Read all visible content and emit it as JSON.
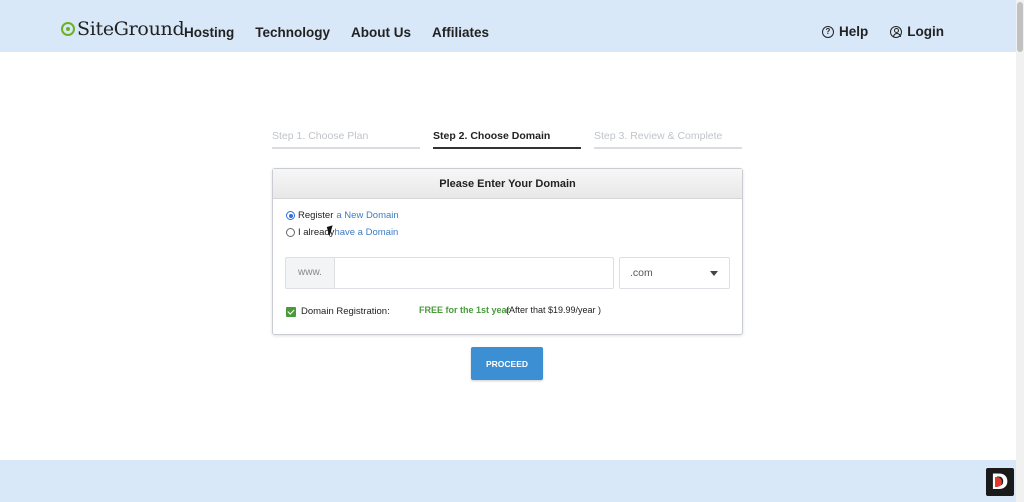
{
  "header": {
    "brand": "SiteGround",
    "nav": [
      "Hosting",
      "Technology",
      "About Us",
      "Affiliates"
    ],
    "help_label": "Help",
    "login_label": "Login",
    "help_icon": "?"
  },
  "steps": [
    {
      "label": "Step 1. Choose Plan",
      "active": false
    },
    {
      "label": "Step 2. Choose Domain",
      "active": true
    },
    {
      "label": "Step 3. Review & Complete",
      "active": false
    }
  ],
  "panel": {
    "title": "Please Enter Your Domain",
    "options": [
      {
        "prefix": "Register",
        "link": "a New Domain",
        "checked": true
      },
      {
        "prefix": "I already",
        "link": "have a Domain",
        "checked": false
      }
    ],
    "www_label": "www.",
    "domain_value": "",
    "tld_selected": ".com",
    "registration_label": "Domain Registration:",
    "registration_checked": true,
    "free_text": "FREE for the 1st year",
    "after_text": "(After that $19.99/year )"
  },
  "proceed_label": "PROCEED",
  "badge_letter": "D",
  "colors": {
    "header_bg": "#d8e8f9",
    "accent_blue": "#3d8fd4",
    "accent_green": "#4a9a3c",
    "link_blue": "#3d7cc4"
  }
}
